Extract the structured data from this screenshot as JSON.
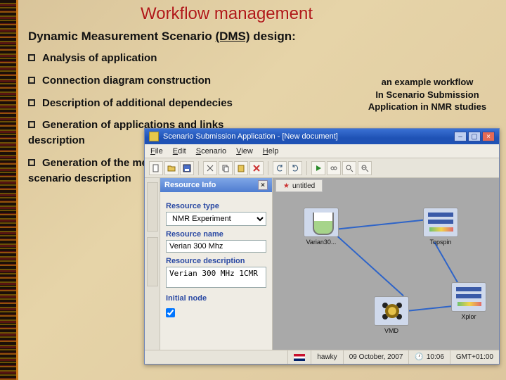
{
  "slide": {
    "title": "Workflow management",
    "subtitle_lead": "Dynamic Measurement Scenario",
    "subtitle_abbr": "(DMS)",
    "subtitle_tail": "design:",
    "bullets": [
      "Analysis of application",
      "Connection diagram construction",
      "Description of additional dependecies",
      "Generation of applications and links description",
      "Generation of the measurement scenario description"
    ],
    "caption_l1": "an example workflow",
    "caption_l2": "In Scenario Submission",
    "caption_l3": "Application in NMR studies"
  },
  "app": {
    "title": "Scenario Submission Application - [New document]",
    "menu": {
      "file": "File",
      "edit": "Edit",
      "scenario": "Scenario",
      "view": "View",
      "help": "Help"
    },
    "doc_tab": "untitled",
    "panel": {
      "header": "Resource Info",
      "type_label": "Resource type",
      "type_value": "NMR Experiment",
      "name_label": "Resource name",
      "name_value": "Verian 300 Mhz",
      "desc_label": "Resource description",
      "desc_value": "Verian 300 MHz 1CMR",
      "initial_label": "Initial node"
    },
    "nodes": {
      "varian": "Varian30...",
      "topspin": "Topspin",
      "xplor": "Xplor",
      "vmd": "VMD"
    },
    "status": {
      "user": "hawky",
      "date": "09 October, 2007",
      "time": "10:06",
      "tz": "GMT+01:00"
    }
  }
}
